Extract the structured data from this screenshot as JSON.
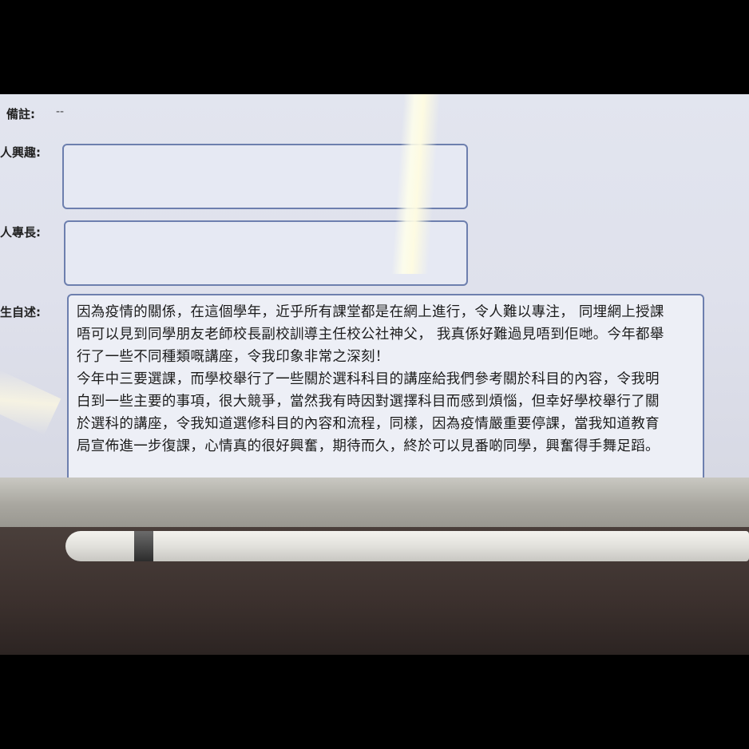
{
  "form": {
    "remark_label": "備註:",
    "remark_value": "--",
    "interest_label": "人興趣:",
    "interest_value": "",
    "specialty_label": "人專長:",
    "specialty_value": "",
    "statement_label": "生自述:",
    "statement_lines": [
      "因為疫情的關係，在這個學年，近乎所有課堂都是在網上進行，令人難以專注， 同埋網上授課",
      "唔可以見到同學朋友老師校長副校訓導主任校公社神父， 我真係好難過見唔到佢哋。今年都舉",
      "行了一些不同種類嘅講座，令我印象非常之深刻！",
      "今年中三要選課，而學校舉行了一些關於選科科目的講座給我們參考關於科目的內容，令我明",
      "白到一些主要的事項，很大競爭，當然我有時因對選擇科目而感到煩惱，但幸好學校舉行了關",
      "於選科的講座，令我知道選修科目的內容和流程，同樣，因為疫情嚴重要停課，當我知道教育",
      "局宣佈進一步復課，心情真的很好興奮，期待而久，終於可以見番啲同學，興奮得手舞足蹈。"
    ]
  }
}
